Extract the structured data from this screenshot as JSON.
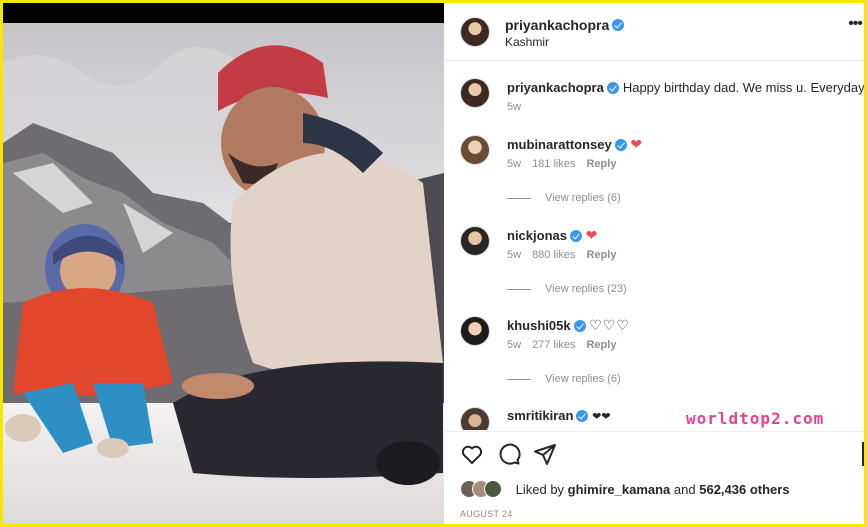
{
  "header": {
    "username": "priyankachopra",
    "location": "Kashmir"
  },
  "comments": [
    {
      "username": "priyankachopra",
      "text": "Happy birthday dad. We miss u. Everyday.",
      "time": "5w",
      "likes": "",
      "reply_label": "",
      "view_replies": ""
    },
    {
      "username": "mubinarattonsey",
      "text": "",
      "time": "5w",
      "likes": "181 likes",
      "reply_label": "Reply",
      "view_replies": "View replies (6)"
    },
    {
      "username": "nickjonas",
      "text": "",
      "time": "5w",
      "likes": "880 likes",
      "reply_label": "Reply",
      "view_replies": "View replies (23)"
    },
    {
      "username": "khushi05k",
      "text": "",
      "time": "5w",
      "likes": "277 likes",
      "reply_label": "Reply",
      "view_replies": "View replies (6)"
    },
    {
      "username": "smritikiran",
      "text": "",
      "time": "",
      "likes": "",
      "reply_label": "",
      "view_replies": ""
    }
  ],
  "likes": {
    "prefix": "Liked by",
    "user": "ghimire_kamana",
    "mid": "and",
    "count": "562,436 others"
  },
  "date": "AUGUST 24",
  "watermark": "worldtop2.com",
  "icons": [
    "more-icon",
    "heart-icon",
    "comment-icon",
    "share-icon",
    "bookmark-icon",
    "verified-icon"
  ],
  "colors": {
    "verified": "#3897f0",
    "heart": "#ed4956",
    "frame": "#f5e800"
  }
}
